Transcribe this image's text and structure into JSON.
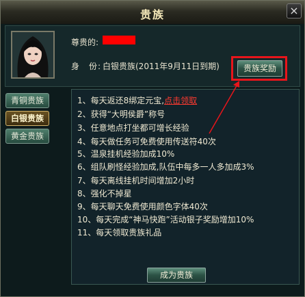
{
  "window": {
    "title": "贵族",
    "close_glyph": "×"
  },
  "profile": {
    "name_label": "尊贵的:",
    "status_label": "身　份:",
    "status_value": "白银贵族(2011年9月11日到期)"
  },
  "buttons": {
    "benefit": "贵族奖励",
    "become": "成为贵族"
  },
  "tabs": [
    {
      "label": "青铜贵族"
    },
    {
      "label": "白银贵族"
    },
    {
      "label": "黄金贵族"
    }
  ],
  "rules": [
    {
      "text": "1、每天返还8绑定元宝,",
      "link": "点击领取"
    },
    {
      "text": "2、获得“大明侯爵”称号"
    },
    {
      "text": "3、任意地点打坐都可增长经验"
    },
    {
      "text": "4、每天做任务可免费使用传送符40次"
    },
    {
      "text": "5、温泉挂机经验加成10%"
    },
    {
      "text": "6、组队刷怪经验加成,队伍中每多一人多加成3%"
    },
    {
      "text": "7、每天离线挂机时间增加2小时"
    },
    {
      "text": "8、强化不掉星"
    },
    {
      "text": "9、每天聊天免费使用颜色字体40次"
    },
    {
      "text": "10、每天完成“神马快跑”活动银子奖励增加10%"
    },
    {
      "text": "11、每天领取贵族礼品"
    }
  ],
  "colors": {
    "highlight": "#e8151b",
    "link": "#ff3a30"
  }
}
